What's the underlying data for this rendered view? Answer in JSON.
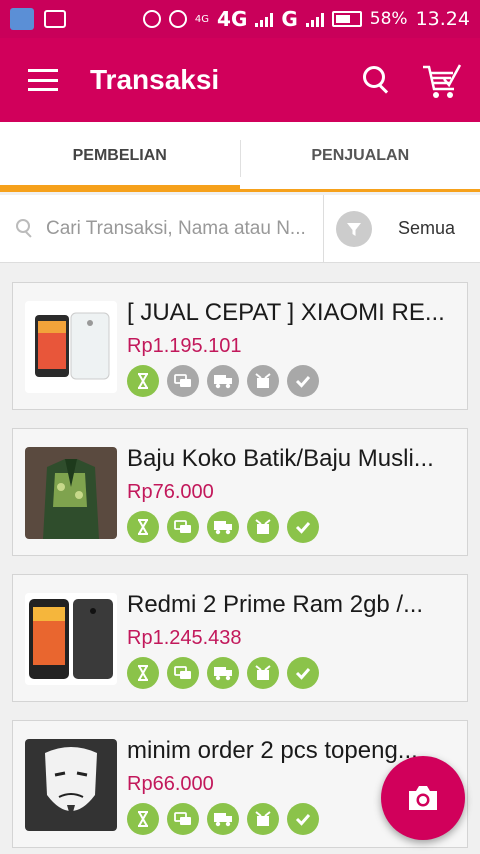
{
  "status_bar": {
    "network_labels": [
      "4G",
      "4G",
      "G"
    ],
    "battery": "58%",
    "time": "13.24"
  },
  "appbar": {
    "title": "Transaksi"
  },
  "tabs": [
    {
      "label": "PEMBELIAN",
      "active": true
    },
    {
      "label": "PENJUALAN",
      "active": false
    }
  ],
  "search": {
    "placeholder": "Cari Transaksi, Nama atau N..."
  },
  "filter": {
    "label": "Semua"
  },
  "transactions": [
    {
      "title": "[ JUAL CEPAT ] XIAOMI RE...",
      "price": "Rp1.195.101",
      "thumb": "white-phone",
      "steps": [
        "hourglass-icon",
        "payment-icon",
        "shipping-icon",
        "received-icon",
        "check-icon"
      ],
      "steps_done": 1
    },
    {
      "title": "Baju Koko Batik/Baju Musli...",
      "price": "Rp76.000",
      "thumb": "batik-shirt",
      "steps": [
        "hourglass-icon",
        "payment-icon",
        "shipping-icon",
        "received-icon",
        "check-icon"
      ],
      "steps_done": 5
    },
    {
      "title": "Redmi 2 Prime Ram 2gb /...",
      "price": "Rp1.245.438",
      "thumb": "black-phone",
      "steps": [
        "hourglass-icon",
        "payment-icon",
        "shipping-icon",
        "received-icon",
        "check-icon"
      ],
      "steps_done": 5
    },
    {
      "title": "minim order 2 pcs topeng...",
      "price": "Rp66.000",
      "thumb": "mask",
      "steps": [
        "hourglass-icon",
        "payment-icon",
        "shipping-icon",
        "received-icon",
        "check-icon"
      ],
      "steps_done": 5
    }
  ],
  "colors": {
    "primary": "#d1005b",
    "accent": "#f6a11b",
    "step_done": "#8bc34a",
    "step_pending": "#a8a8a8",
    "price": "#c2185b"
  }
}
